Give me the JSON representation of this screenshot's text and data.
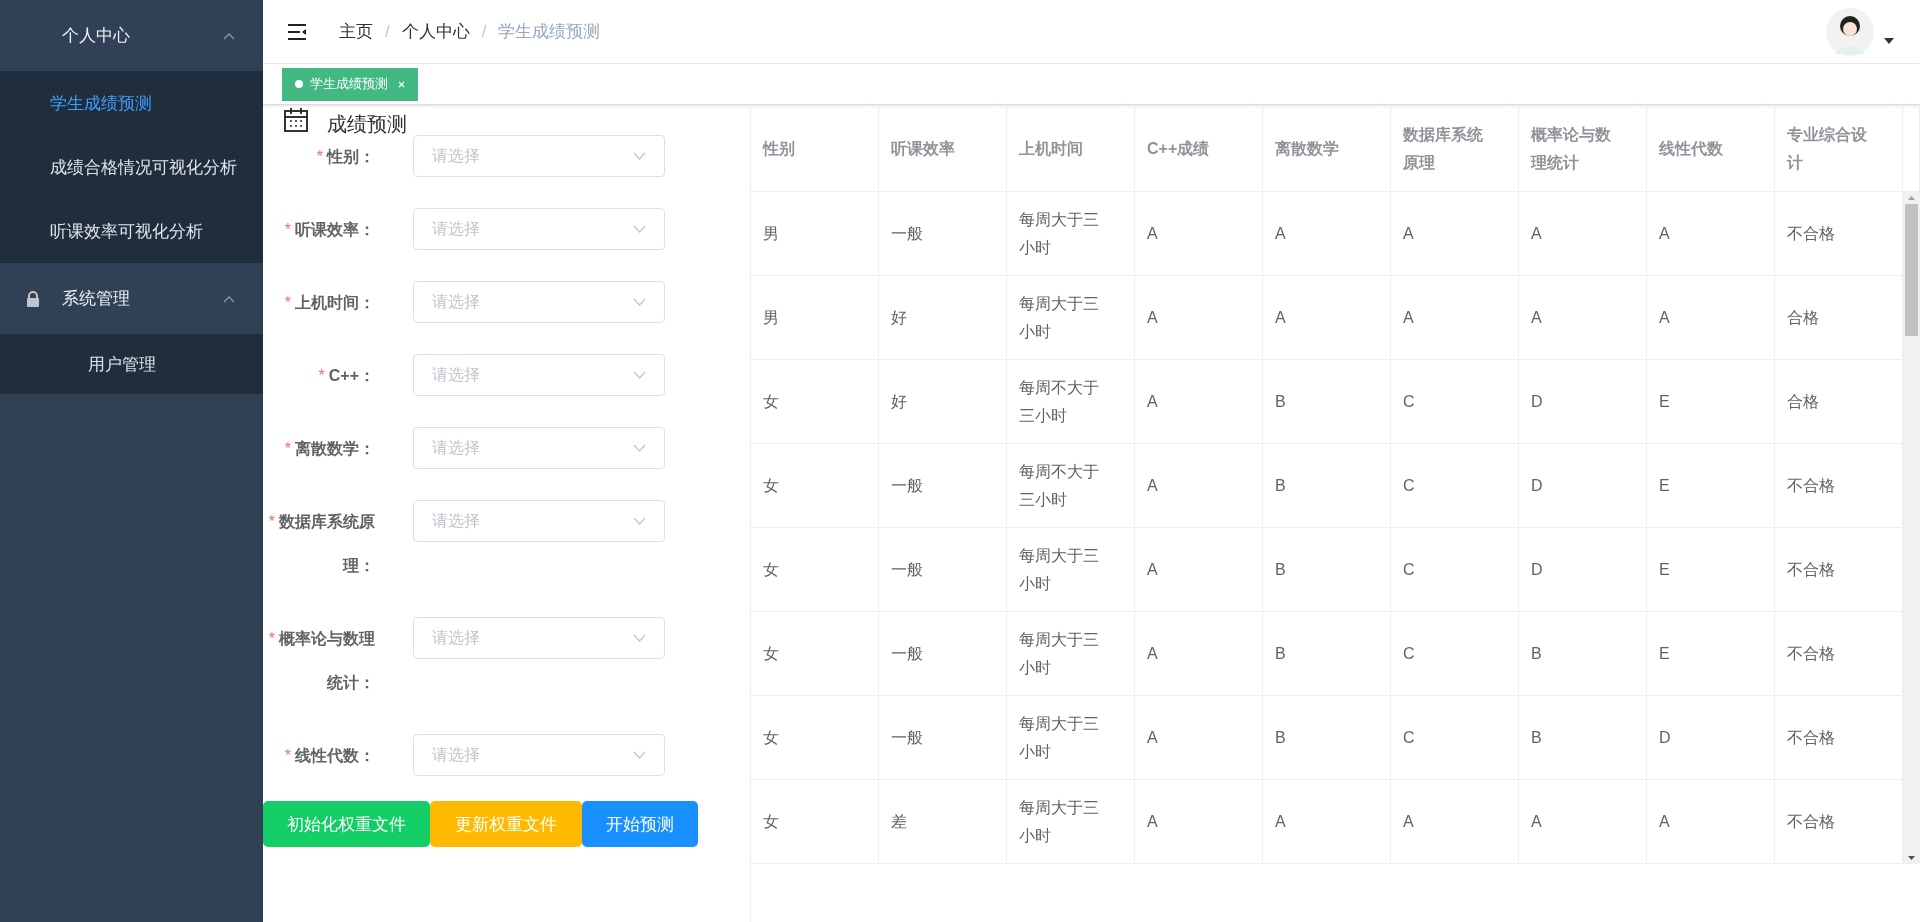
{
  "sidebar": {
    "groups": [
      {
        "title": "个人中心",
        "kind": "plain",
        "expanded": true,
        "items": [
          {
            "label": "学生成绩预测",
            "selected": true
          },
          {
            "label": "成绩合格情况可视化分析",
            "selected": false
          },
          {
            "label": "听课效率可视化分析",
            "selected": false
          }
        ]
      },
      {
        "title": "系统管理",
        "kind": "locked",
        "expanded": true,
        "items": [
          {
            "label": "用户管理",
            "selected": false
          }
        ]
      }
    ]
  },
  "breadcrumb": {
    "separator": "/",
    "items": [
      "主页",
      "个人中心",
      "学生成绩预测"
    ]
  },
  "tags": [
    {
      "label": "学生成绩预测",
      "selected": true
    }
  ],
  "form": {
    "title": "成绩预测",
    "fields": [
      {
        "mark": "*",
        "label": "性别：",
        "placeholder": "请选择"
      },
      {
        "mark": "*",
        "label": "听课效率：",
        "placeholder": "请选择"
      },
      {
        "mark": "*",
        "label": "上机时间：",
        "placeholder": "请选择"
      },
      {
        "mark": "*",
        "label": "C++：",
        "placeholder": "请选择"
      },
      {
        "mark": "*",
        "label": "离散数学：",
        "placeholder": "请选择"
      },
      {
        "mark": "*",
        "label": "数据库系统原理：",
        "placeholder": "请选择"
      },
      {
        "mark": "*",
        "label": "概率论与数理统计：",
        "placeholder": "请选择"
      },
      {
        "mark": "*",
        "label": "线性代数：",
        "placeholder": "请选择"
      }
    ],
    "buttons": [
      {
        "label": "初始化权重文件",
        "color": "#13ce66"
      },
      {
        "label": "更新权重文件",
        "color": "#ffba00"
      },
      {
        "label": "开始预测",
        "color": "#1890ff"
      }
    ]
  },
  "table": {
    "columns": [
      "性别",
      "听课效率",
      "上机时间",
      "C++成绩",
      "离散数学",
      "数据库系统原理",
      "概率论与数理统计",
      "线性代数",
      "专业综合设计"
    ],
    "rows": [
      [
        "男",
        "一般",
        "每周大于三小时",
        "A",
        "A",
        "A",
        "A",
        "A",
        "不合格"
      ],
      [
        "男",
        "好",
        "每周大于三小时",
        "A",
        "A",
        "A",
        "A",
        "A",
        "合格"
      ],
      [
        "女",
        "好",
        "每周不大于三小时",
        "A",
        "B",
        "C",
        "D",
        "E",
        "合格"
      ],
      [
        "女",
        "一般",
        "每周不大于三小时",
        "A",
        "B",
        "C",
        "D",
        "E",
        "不合格"
      ],
      [
        "女",
        "一般",
        "每周大于三小时",
        "A",
        "B",
        "C",
        "D",
        "E",
        "不合格"
      ],
      [
        "女",
        "一般",
        "每周大于三小时",
        "A",
        "B",
        "C",
        "B",
        "E",
        "不合格"
      ],
      [
        "女",
        "一般",
        "每周大于三小时",
        "A",
        "B",
        "C",
        "B",
        "D",
        "不合格"
      ],
      [
        "女",
        "差",
        "每周大于三小时",
        "A",
        "A",
        "A",
        "A",
        "A",
        "不合格"
      ]
    ]
  }
}
